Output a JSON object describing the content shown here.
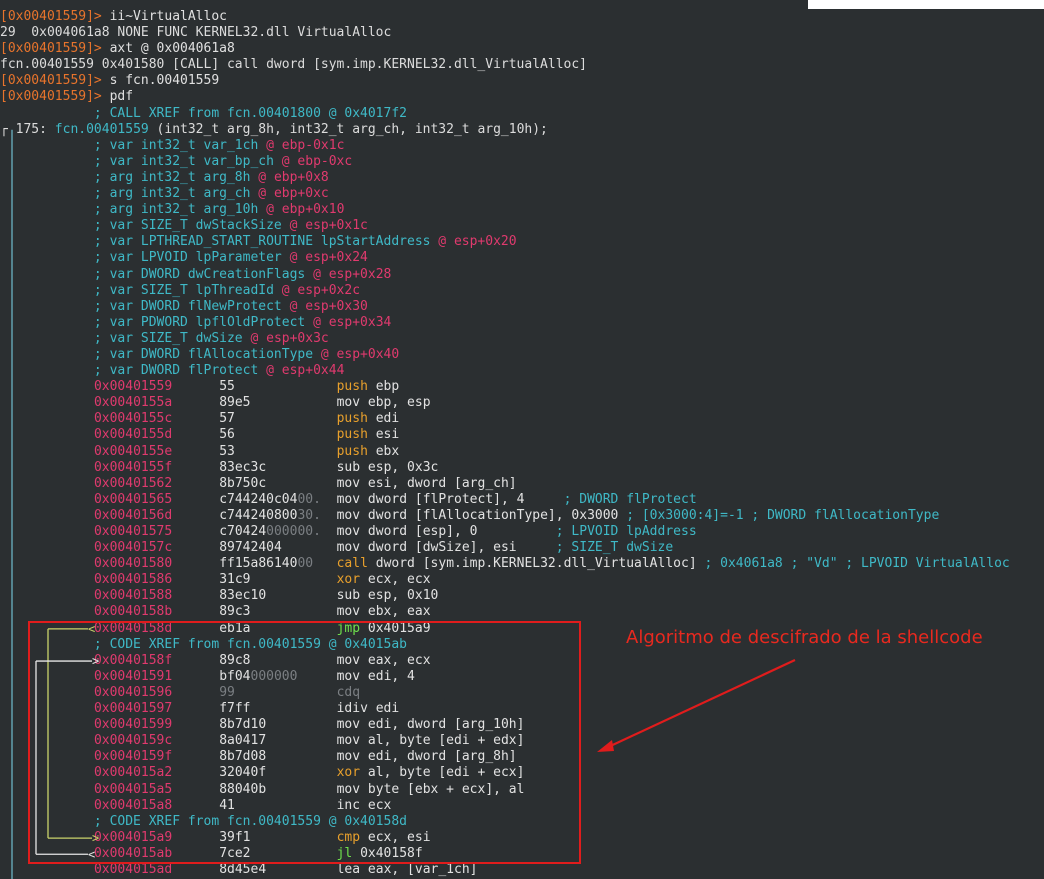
{
  "terminal": {
    "lines": [
      {
        "type": "cmd",
        "prompt": "[0x00401559]>",
        "text": " ii~VirtualAlloc"
      },
      {
        "type": "out",
        "text": "29  0x004061a8 NONE FUNC KERNEL32.dll VirtualAlloc"
      },
      {
        "type": "cmd",
        "prompt": "[0x00401559]>",
        "text": " axt @ 0x004061a8"
      },
      {
        "type": "out",
        "text": "fcn.00401559 0x401580 [CALL] call dword [sym.imp.KERNEL32.dll_VirtualAlloc]"
      },
      {
        "type": "cmd",
        "prompt": "[0x00401559]>",
        "text": " s fcn.00401559"
      },
      {
        "type": "cmd",
        "prompt": "[0x00401559]>",
        "text": " pdf"
      },
      {
        "type": "comment",
        "indent": "            ",
        "text": "; CALL XREF from fcn.00401800 @ 0x4017f2"
      },
      {
        "type": "funchead",
        "pre": "┌ 175: ",
        "name": "fcn.00401559",
        "args": " (int32_t arg_8h, int32_t arg_ch, int32_t arg_10h);"
      },
      {
        "type": "var",
        "text": "; var int32_t var_1ch",
        "at": " @ ebp-0x1c"
      },
      {
        "type": "var",
        "text": "; var int32_t var_bp_ch",
        "at": " @ ebp-0xc"
      },
      {
        "type": "var",
        "text": "; arg int32_t arg_8h",
        "at": " @ ebp+0x8"
      },
      {
        "type": "var",
        "text": "; arg int32_t arg_ch",
        "at": " @ ebp+0xc"
      },
      {
        "type": "var",
        "text": "; arg int32_t arg_10h",
        "at": " @ ebp+0x10"
      },
      {
        "type": "var",
        "text": "; var SIZE_T dwStackSize",
        "at": " @ esp+0x1c"
      },
      {
        "type": "var",
        "text": "; var LPTHREAD_START_ROUTINE lpStartAddress",
        "at": " @ esp+0x20"
      },
      {
        "type": "var",
        "text": "; var LPVOID lpParameter",
        "at": " @ esp+0x24"
      },
      {
        "type": "var",
        "text": "; var DWORD dwCreationFlags",
        "at": " @ esp+0x28"
      },
      {
        "type": "var",
        "text": "; var SIZE_T lpThreadId",
        "at": " @ esp+0x2c"
      },
      {
        "type": "var",
        "text": "; var DWORD flNewProtect",
        "at": " @ esp+0x30"
      },
      {
        "type": "var",
        "text": "; var PDWORD lpflOldProtect",
        "at": " @ esp+0x34"
      },
      {
        "type": "var",
        "text": "; var SIZE_T dwSize",
        "at": " @ esp+0x3c"
      },
      {
        "type": "var",
        "text": "; var DWORD flAllocationType",
        "at": " @ esp+0x40"
      },
      {
        "type": "var",
        "text": "; var DWORD flProtect",
        "at": " @ esp+0x44"
      },
      {
        "type": "asm",
        "addr": "0x00401559",
        "bytes": "55",
        "bytesDim": "",
        "op": "push ebp",
        "opClass": "c-op-push",
        "note": ""
      },
      {
        "type": "asm",
        "addr": "0x0040155a",
        "bytes": "89e5",
        "bytesDim": "",
        "op": "mov ebp, esp",
        "opClass": "c-op",
        "note": ""
      },
      {
        "type": "asm",
        "addr": "0x0040155c",
        "bytes": "57",
        "bytesDim": "",
        "op": "push edi",
        "opClass": "c-op-push",
        "note": ""
      },
      {
        "type": "asm",
        "addr": "0x0040155d",
        "bytes": "56",
        "bytesDim": "",
        "op": "push esi",
        "opClass": "c-op-push",
        "note": ""
      },
      {
        "type": "asm",
        "addr": "0x0040155e",
        "bytes": "53",
        "bytesDim": "",
        "op": "push ebx",
        "opClass": "c-op-push",
        "note": ""
      },
      {
        "type": "asm",
        "addr": "0x0040155f",
        "bytes": "83ec3c",
        "bytesDim": "",
        "op": "sub esp, 0x3c",
        "opClass": "c-op",
        "note": ""
      },
      {
        "type": "asm",
        "addr": "0x00401562",
        "bytes": "8b750c",
        "bytesDim": "",
        "op": "mov esi, dword [arg_ch]",
        "opClass": "c-op",
        "note": ""
      },
      {
        "type": "asm",
        "addr": "0x00401565",
        "bytes": "c744240c04",
        "bytesDim": "00.",
        "op": "mov dword [flProtect], 4",
        "opClass": "c-op",
        "note": "     ; DWORD flProtect"
      },
      {
        "type": "asm",
        "addr": "0x0040156d",
        "bytes": "c744240800",
        "bytesDim": "30.",
        "op": "mov dword [flAllocationType], 0x3000",
        "opClass": "c-op",
        "note": " ; [0x3000:4]=-1 ; DWORD flAllocationType"
      },
      {
        "type": "asm",
        "addr": "0x00401575",
        "bytes": "c70424",
        "bytesDim": "000000.",
        "op": "mov dword [esp], 0",
        "opClass": "c-op",
        "note": "          ; LPVOID lpAddress"
      },
      {
        "type": "asm",
        "addr": "0x0040157c",
        "bytes": "89742404",
        "bytesDim": "",
        "op": "mov dword [dwSize], esi",
        "opClass": "c-op",
        "note": "     ; SIZE_T dwSize"
      },
      {
        "type": "asm",
        "addr": "0x00401580",
        "bytes": "ff15a86140",
        "bytesDim": "00",
        "op": "call dword [sym.imp.KERNEL32.dll_VirtualAlloc]",
        "opClass": "c-op-call",
        "note": " ; 0x4061a8 ; \"Vd\" ; LPVOID VirtualAlloc"
      },
      {
        "type": "asm",
        "addr": "0x00401586",
        "bytes": "31c9",
        "bytesDim": "",
        "op": "xor ecx, ecx",
        "opClass": "c-op-xor",
        "note": ""
      },
      {
        "type": "asm",
        "addr": "0x00401588",
        "bytes": "83ec10",
        "bytesDim": "",
        "op": "sub esp, 0x10",
        "opClass": "c-op",
        "note": ""
      },
      {
        "type": "asm",
        "addr": "0x0040158b",
        "bytes": "89c3",
        "bytesDim": "",
        "op": "mov ebx, eax",
        "opClass": "c-op",
        "note": ""
      },
      {
        "type": "asm",
        "addr": "0x0040158d",
        "bytes": "eb1a",
        "bytesDim": "",
        "op": "jmp 0x4015a9",
        "opClass": "c-op-jmp",
        "note": "",
        "arrow": "┌─< "
      },
      {
        "type": "xref",
        "text": "; CODE XREF from fcn.00401559 @ 0x4015ab",
        "arrow": "│"
      },
      {
        "type": "asm",
        "addr": "0x0040158f",
        "bytes": "89c8",
        "bytesDim": "",
        "op": "mov eax, ecx",
        "opClass": "c-op",
        "note": "",
        "arrow": "┌──> "
      },
      {
        "type": "asm",
        "addr": "0x00401591",
        "bytes": "bf04",
        "bytesDim": "000000",
        "op": "mov edi, 4",
        "opClass": "c-op",
        "note": "",
        "arrow": "│"
      },
      {
        "type": "asm",
        "addr": "0x00401596",
        "bytes": "",
        "bytesDim": "99",
        "op": "cdq",
        "opClass": "c-op-cdq",
        "note": "",
        "arrow": "│"
      },
      {
        "type": "asm",
        "addr": "0x00401597",
        "bytes": "f7ff",
        "bytesDim": "",
        "op": "idiv edi",
        "opClass": "c-op",
        "note": "",
        "arrow": "│"
      },
      {
        "type": "asm",
        "addr": "0x00401599",
        "bytes": "8b7d10",
        "bytesDim": "",
        "op": "mov edi, dword [arg_10h]",
        "opClass": "c-op",
        "note": "",
        "arrow": "│"
      },
      {
        "type": "asm",
        "addr": "0x0040159c",
        "bytes": "8a0417",
        "bytesDim": "",
        "op": "mov al, byte [edi + edx]",
        "opClass": "c-op",
        "note": "",
        "arrow": "│"
      },
      {
        "type": "asm",
        "addr": "0x0040159f",
        "bytes": "8b7d08",
        "bytesDim": "",
        "op": "mov edi, dword [arg_8h]",
        "opClass": "c-op",
        "note": "",
        "arrow": "│"
      },
      {
        "type": "asm",
        "addr": "0x004015a2",
        "bytes": "32040f",
        "bytesDim": "",
        "op": "xor al, byte [edi + ecx]",
        "opClass": "c-op-xor",
        "note": "",
        "arrow": "│"
      },
      {
        "type": "asm",
        "addr": "0x004015a5",
        "bytes": "88040b",
        "bytesDim": "",
        "op": "mov byte [ebx + ecx], al",
        "opClass": "c-op",
        "note": "",
        "arrow": "│"
      },
      {
        "type": "asm",
        "addr": "0x004015a8",
        "bytes": "41",
        "bytesDim": "",
        "op": "inc ecx",
        "opClass": "c-op",
        "note": "",
        "arrow": "│"
      },
      {
        "type": "xref",
        "text": "; CODE XREF from fcn.00401559 @ 0x40158d",
        "arrow": "│"
      },
      {
        "type": "asm",
        "addr": "0x004015a9",
        "bytes": "39f1",
        "bytesDim": "",
        "op": "cmp ecx, esi",
        "opClass": "c-op-cmp",
        "note": "",
        "arrow": "│└─> "
      },
      {
        "type": "asm",
        "addr": "0x004015ab",
        "bytes": "7ce2",
        "bytesDim": "",
        "op": "jl 0x40158f",
        "opClass": "c-op-jmp",
        "note": "",
        "arrow": "└──< "
      },
      {
        "type": "asm",
        "addr": "0x004015ad",
        "bytes": "8d45e4",
        "bytesDim": "",
        "op": "lea eax, [var_1ch]",
        "opClass": "c-op",
        "note": ""
      }
    ]
  },
  "annotation": {
    "label": "Algoritmo de descifrado de la shellcode",
    "color": "#e01c1c"
  }
}
